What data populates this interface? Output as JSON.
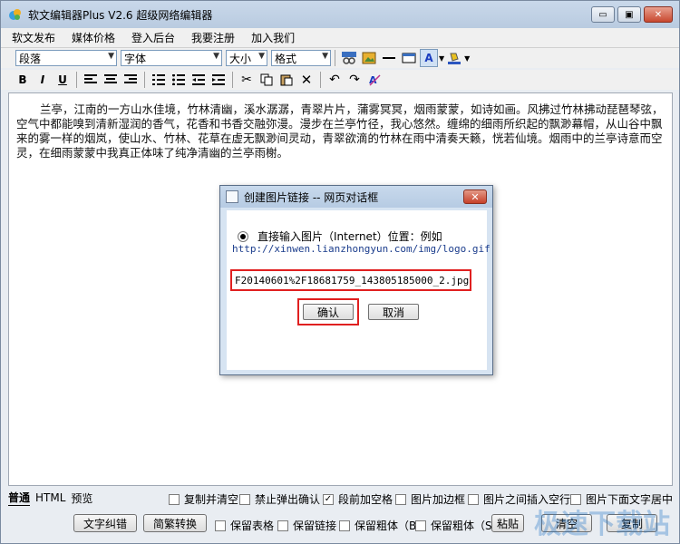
{
  "app": {
    "title": "软文编辑器Plus V2.6 超级网络编辑器",
    "window_controls": {
      "minimize": "▭",
      "restore": "▣",
      "close": "✕"
    }
  },
  "menu": [
    "软文发布",
    "媒体价格",
    "登入后台",
    "我要注册",
    "加入我们"
  ],
  "toolbar1": {
    "paragraph": "段落",
    "font": "字体",
    "size": "大小",
    "format": "格式"
  },
  "toolbar2": {
    "bold": "B",
    "italic": "I",
    "underline": "U"
  },
  "editor": {
    "text": "兰亭，江南的一方山水佳境，竹林清幽，溪水潺潺，青翠片片，蒲雾冥冥，烟雨蒙蒙，如诗如画。风拂过竹林拂动琵琶琴弦，空气中都能嗅到清新湿润的香气，花香和书香交融弥漫。漫步在兰亭竹径，我心悠然。缠绵的细雨所织起的飘渺幕帽，从山谷中飘来的雾一样的烟岚，使山水、竹林、花草在虚无飘渺间灵动，青翠欲滴的竹林在雨中清奏天籁，恍若仙境。烟雨中的兰亭诗意而空灵，在细雨蒙蒙中我真正体味了纯净清幽的兰亭雨榭。"
  },
  "dialog": {
    "title": "创建图片链接 -- 网页对话框",
    "close": "✕",
    "radio_label": "直接输入图片（Internet）位置：例如",
    "example_url": "http://xinwen.lianzhongyun.com/img/logo.gif",
    "input_value": "F20140601%2F18681759_143805185000_2.jpg",
    "ok": "确认",
    "cancel": "取消"
  },
  "bottom_tabs": [
    "普通",
    "HTML",
    "预览"
  ],
  "options_row1": [
    {
      "label": "复制并清空",
      "checked": false
    },
    {
      "label": "禁止弹出确认",
      "checked": false
    },
    {
      "label": "段前加空格",
      "checked": true
    },
    {
      "label": "图片加边框",
      "checked": false
    },
    {
      "label": "图片之间插入空行",
      "checked": false
    },
    {
      "label": "图片下面文字居中",
      "checked": false
    }
  ],
  "buttons_row2": {
    "spell": "文字纠错",
    "convert": "简繁转换",
    "paste": "粘贴",
    "clear": "清空",
    "copy": "复制"
  },
  "options_row2": [
    {
      "label": "保留表格",
      "checked": false
    },
    {
      "label": "保留链接",
      "checked": false
    },
    {
      "label": "保留粗体（B）",
      "checked": false
    },
    {
      "label": "保留粗体（S）",
      "checked": false
    }
  ],
  "watermark": "极速下载站",
  "colors": {
    "highlight": "#e02020",
    "link": "#1a3c8c",
    "accent": "#2878c8"
  }
}
